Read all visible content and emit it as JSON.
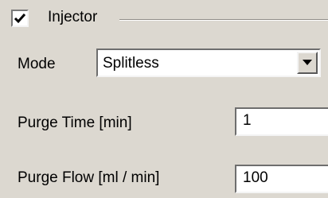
{
  "injector_group": {
    "enabled": true,
    "title": "Injector"
  },
  "fields": {
    "mode_label": "Mode",
    "mode_value": "Splitless",
    "purge_time_label": "Purge Time [min]",
    "purge_time_value": "1",
    "purge_flow_label": "Purge Flow [ml / min]",
    "purge_flow_value": "100"
  },
  "icons": {
    "checkbox": "checkmark-icon",
    "dropdown": "chevron-down-icon"
  }
}
